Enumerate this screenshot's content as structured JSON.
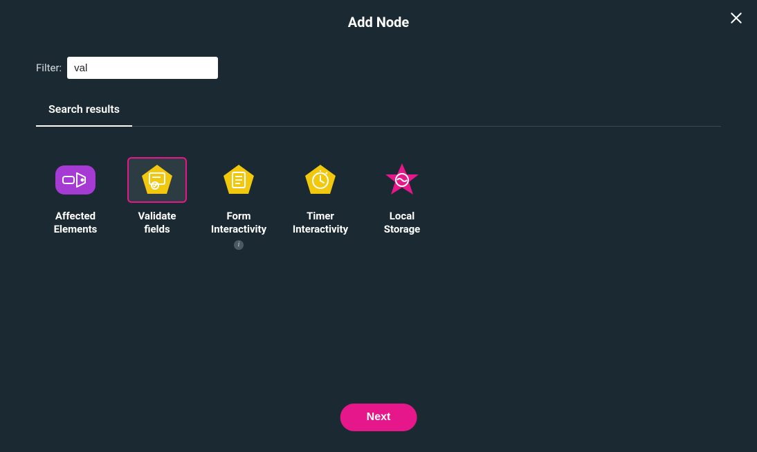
{
  "header": {
    "title": "Add Node"
  },
  "filter": {
    "label": "Filter:",
    "value": "val"
  },
  "tabs": {
    "active": "Search results"
  },
  "nodes": [
    {
      "label": "Affected Elements"
    },
    {
      "label": "Validate fields"
    },
    {
      "label": "Form Interactivity"
    },
    {
      "label": "Timer Interactivity"
    },
    {
      "label": "Local Storage"
    }
  ],
  "footer": {
    "next_label": "Next"
  },
  "colors": {
    "accent_pink": "#e6178b",
    "yellow": "#f2c80f",
    "purple": "#a63bd4",
    "background": "#1b2a32"
  }
}
